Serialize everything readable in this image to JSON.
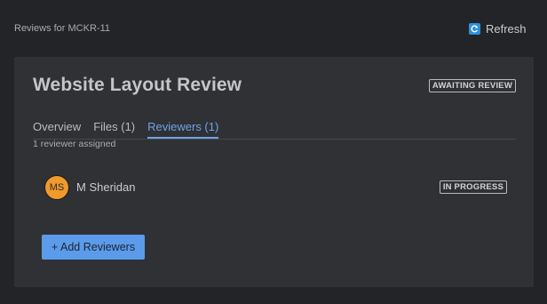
{
  "header": {
    "context_label": "Reviews for MCKR-11",
    "refresh_label": "Refresh",
    "refresh_icon": "refresh-icon"
  },
  "review": {
    "title": "Website Layout Review",
    "status": "AWAITING REVIEW"
  },
  "tabs": [
    {
      "label": "Overview",
      "active": false
    },
    {
      "label": "Files (1)",
      "active": false
    },
    {
      "label": "Reviewers (1)",
      "active": true
    }
  ],
  "reviewers": {
    "summary": "1 reviewer assigned",
    "items": [
      {
        "initials": "MS",
        "name": "M Sheridan",
        "status": "IN PROGRESS"
      }
    ],
    "add_label": "+ Add Reviewers"
  },
  "colors": {
    "accent": "#5b9bea",
    "active_tab": "#6fa3e6",
    "avatar": "#f09a2b",
    "panel": "#303135",
    "background": "#232427"
  }
}
